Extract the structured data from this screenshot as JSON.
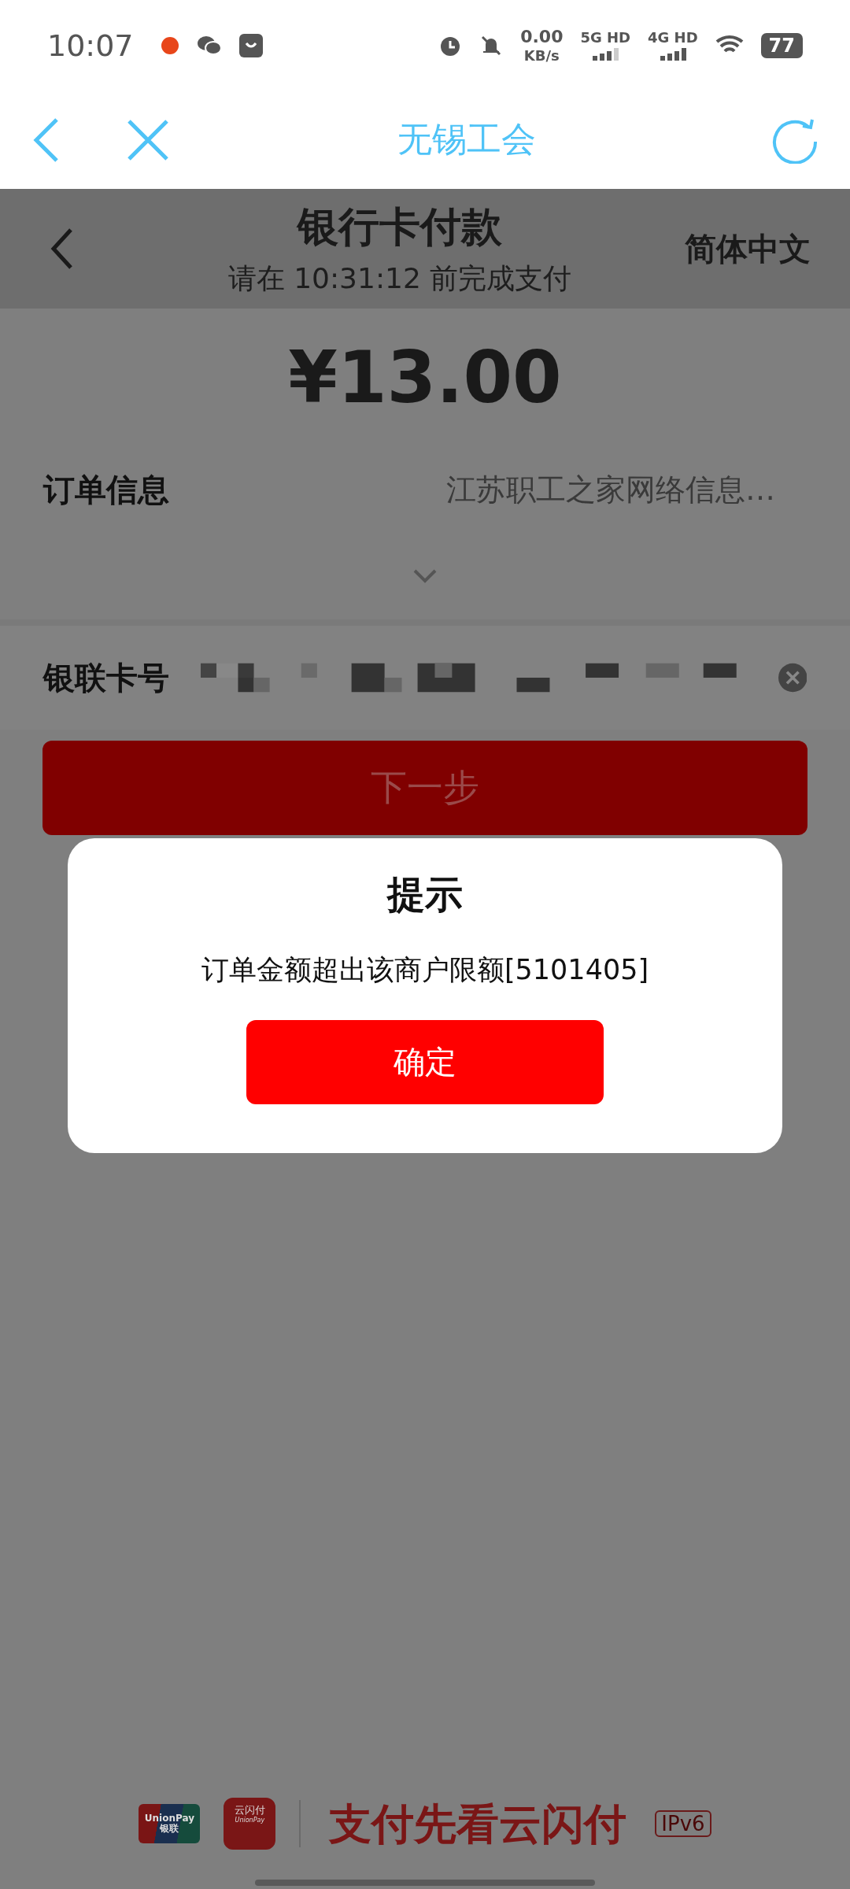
{
  "status_bar": {
    "time": "10:07",
    "net_speed": "0.00",
    "net_unit": "KB/s",
    "sim1": "5G HD",
    "sim2": "4G HD",
    "battery": "77"
  },
  "app_bar": {
    "title": "无锡工会"
  },
  "page": {
    "title": "银行卡付款",
    "deadline": "请在 10:31:12 前完成支付",
    "language": "简体中文"
  },
  "amount": "¥13.00",
  "order": {
    "label": "订单信息",
    "value": "江苏职工之家网络信息…"
  },
  "card": {
    "label": "银联卡号"
  },
  "next_button": "下一步",
  "dialog": {
    "title": "提示",
    "message": "订单金额超出该商户限额[5101405]",
    "confirm": "确定"
  },
  "footer": {
    "unionpay_logo": [
      "UnionPay",
      "银联"
    ],
    "app_logo": [
      "云闪付",
      "UnionPay"
    ],
    "slogan": "支付先看云闪付",
    "badge": "IPv6"
  }
}
